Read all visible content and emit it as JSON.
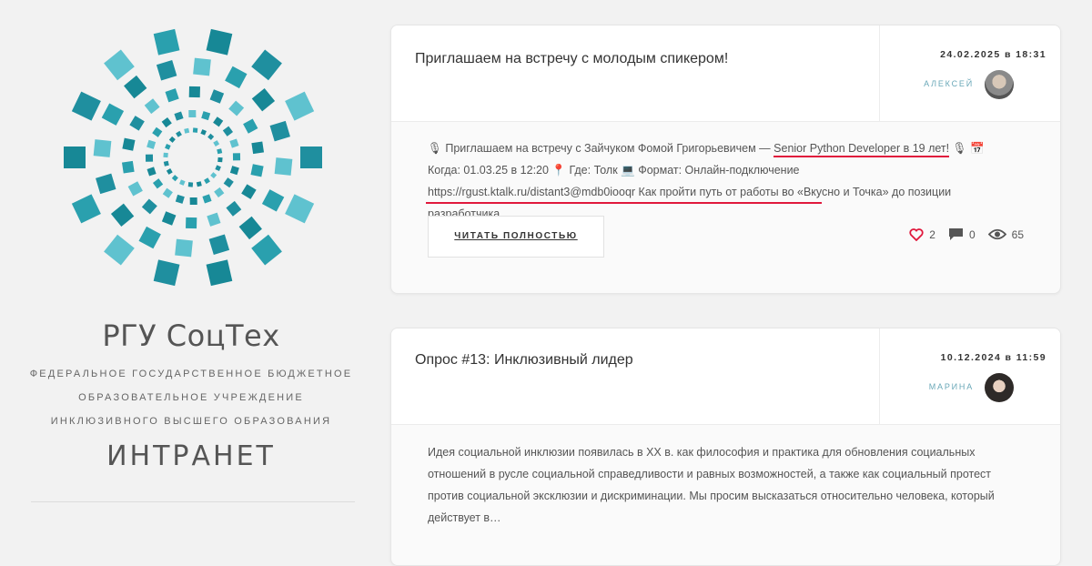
{
  "sidebar": {
    "title": "РГУ СоцТех",
    "subtitle_line1": "Федеральное государственное бюджетное",
    "subtitle_line2": "образовательное учреждение",
    "subtitle_line3": "инклюзивного высшего образования",
    "section": "ИНТРАНЕТ"
  },
  "posts": [
    {
      "title": "Приглашаем на встречу с молодым спикером!",
      "date": "24.02.2025 в 18:31",
      "author": "Алексей",
      "excerpt_pre": "🎙 Приглашаем на встречу с Зайчуком Фомой Григорьевичем — ",
      "excerpt_highlight": "Senior Python Developer в 19 лет!",
      "excerpt_post": " 🎙 📅 Когда: 01.03.25 в 12:20 📍 Где: Толк 💻 Формат: Онлайн-подключение https://rgust.ktalk.ru/distant3@mdb0iooqr Как пройти путь от работы во «Вкусно и Точка» до позиции разработчика…",
      "read_more": "Читать полностью",
      "likes": "2",
      "comments": "0",
      "views": "65"
    },
    {
      "title": "Опрос #13: Инклюзивный лидер",
      "date": "10.12.2024 в 11:59",
      "author": "Марина",
      "excerpt": "Идея социальной инклюзии появилась в XX в. как философия и практика для обновления социальных отношений в русле социальной справедливости и равных возможностей, а также как социальный протест против социальной эксклюзии и дискриминации. Мы просим высказаться относительно человека, который действует в…"
    }
  ],
  "colors": {
    "accent": "#e0183c",
    "logo_teal": "#1f8f9f",
    "logo_light": "#5fc2cf"
  }
}
